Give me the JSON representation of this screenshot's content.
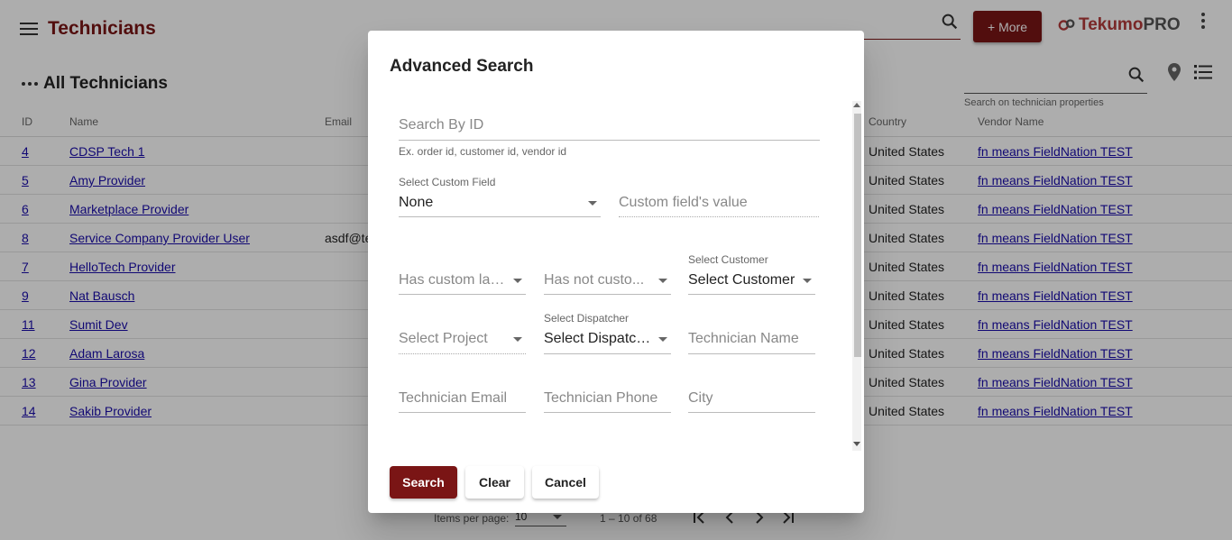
{
  "header": {
    "title": "Technicians",
    "more_label": "+ More",
    "logo_text_a": "Tekumo",
    "logo_text_b": "PRO"
  },
  "subheader": {
    "title": "All Technicians",
    "search_hint": "Search on technician properties"
  },
  "table": {
    "columns": [
      "ID",
      "Name",
      "Email",
      "Country",
      "Vendor Name"
    ],
    "rows": [
      {
        "id": "4",
        "name": "CDSP Tech 1",
        "email": "",
        "country": "United States",
        "vendor": "fn means FieldNation TEST"
      },
      {
        "id": "5",
        "name": "Amy Provider",
        "email": "",
        "country": "United States",
        "vendor": "fn means FieldNation TEST"
      },
      {
        "id": "6",
        "name": "Marketplace Provider",
        "email": "",
        "country": "United States",
        "vendor": "fn means FieldNation TEST"
      },
      {
        "id": "8",
        "name": "Service Company Provider User",
        "email": "asdf@te",
        "country": "United States",
        "vendor": "fn means FieldNation TEST"
      },
      {
        "id": "7",
        "name": "HelloTech Provider",
        "email": "",
        "country": "United States",
        "vendor": "fn means FieldNation TEST"
      },
      {
        "id": "9",
        "name": "Nat Bausch",
        "email": "",
        "country": "United States",
        "vendor": "fn means FieldNation TEST"
      },
      {
        "id": "11",
        "name": "Sumit Dev",
        "email": "",
        "country": "United States",
        "vendor": "fn means FieldNation TEST"
      },
      {
        "id": "12",
        "name": "Adam Larosa",
        "email": "",
        "country": "United States",
        "vendor": "fn means FieldNation TEST"
      },
      {
        "id": "13",
        "name": "Gina Provider",
        "email": "",
        "country": "United States",
        "vendor": "fn means FieldNation TEST"
      },
      {
        "id": "14",
        "name": "Sakib Provider",
        "email": "",
        "country": "United States",
        "vendor": "fn means FieldNation TEST"
      }
    ]
  },
  "paginator": {
    "items_per_page_label": "Items per page:",
    "items_per_page": "10",
    "range": "1 – 10 of 68"
  },
  "dialog": {
    "title": "Advanced Search",
    "search_by_id": {
      "placeholder": "Search By ID",
      "hint": "Ex. order id, customer id, vendor id"
    },
    "custom_field": {
      "label": "Select Custom Field",
      "value": "None"
    },
    "custom_field_value": {
      "placeholder": "Custom field's value"
    },
    "has_custom_label": {
      "placeholder": "Has custom lab..."
    },
    "has_not_custom": {
      "placeholder": "Has not custo..."
    },
    "customer": {
      "label": "Select Customer",
      "value": "Select Customer"
    },
    "project": {
      "placeholder": "Select Project"
    },
    "dispatcher": {
      "label": "Select Dispatcher",
      "value": "Select Dispatch..."
    },
    "technician_name": {
      "placeholder": "Technician Name"
    },
    "technician_email": {
      "placeholder": "Technician Email"
    },
    "technician_phone": {
      "placeholder": "Technician Phone"
    },
    "city": {
      "placeholder": "City"
    },
    "actions": {
      "search": "Search",
      "clear": "Clear",
      "cancel": "Cancel"
    }
  },
  "colors": {
    "brand": "#7a1515",
    "link": "#1a0dab"
  }
}
